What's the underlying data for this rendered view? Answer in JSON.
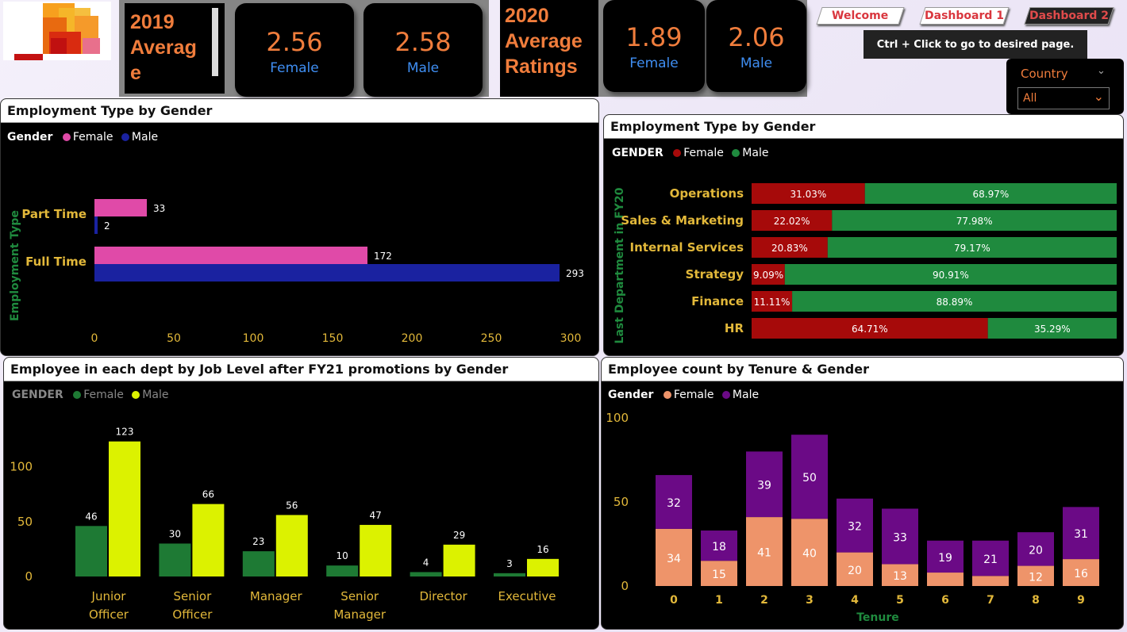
{
  "kpi2019": {
    "title": "2019\nAverag\ne",
    "female_value": "2.56",
    "female_label": "Female",
    "male_value": "2.58",
    "male_label": "Male"
  },
  "kpi2020": {
    "title": "2020\nAverage\nRatings",
    "female_value": "1.89",
    "female_label": "Female",
    "male_value": "2.06",
    "male_label": "Male"
  },
  "nav": {
    "welcome": "Welcome",
    "dashboard1": "Dashboard 1",
    "dashboard2": "Dashboard 2",
    "tip": "Ctrl + Click to go to desired page."
  },
  "slicer": {
    "label": "Country",
    "value": "All"
  },
  "panels": {
    "emp_type": {
      "title": "Employment Type by Gender",
      "legend_title": "Gender",
      "female": "Female",
      "male": "Male"
    },
    "dept": {
      "title": "Employment Type by Gender",
      "legend_title": "GENDER",
      "female": "Female",
      "male": "Male"
    },
    "joblevel": {
      "title": "Employee in each dept by Job Level after FY21 promotions by Gender",
      "legend_title": "GENDER",
      "female": "Female",
      "male": "Male"
    },
    "tenure": {
      "title": "Employee count by Tenure & Gender",
      "legend_title": "Gender",
      "female": "Female",
      "male": "Male"
    }
  },
  "colors": {
    "accent_orange": "#f07d3c",
    "blue_label": "#3f8ef2",
    "pink": "#e04aa8",
    "navy": "#1a22a0",
    "dark_red": "#a60a0a",
    "green": "#1f8a3e",
    "dark_green": "#1e7a34",
    "lime": "#dcf200",
    "salmon": "#ee946a",
    "purple": "#6b0a86",
    "gold": "#e2b83a"
  },
  "chart_data": [
    {
      "type": "bar",
      "orientation": "horizontal",
      "title": "Employment Type by Gender",
      "ylabel": "Employment Type",
      "categories": [
        "Part Time",
        "Full Time"
      ],
      "series": [
        {
          "name": "Female",
          "values": [
            33,
            172
          ]
        },
        {
          "name": "Male",
          "values": [
            2,
            293
          ]
        }
      ],
      "xticks": [
        0,
        50,
        100,
        150,
        200,
        250,
        300
      ],
      "xlim": [
        0,
        300
      ]
    },
    {
      "type": "bar",
      "orientation": "horizontal",
      "stacked": "percent",
      "title": "Employment Type by Gender",
      "ylabel": "Last Department in FY20",
      "categories": [
        "Operations",
        "Sales & Marketing",
        "Internal Services",
        "Strategy",
        "Finance",
        "HR"
      ],
      "series": [
        {
          "name": "Female",
          "values": [
            31.03,
            22.02,
            20.83,
            9.09,
            11.11,
            64.71
          ]
        },
        {
          "name": "Male",
          "values": [
            68.97,
            77.98,
            79.17,
            90.91,
            88.89,
            35.29
          ]
        }
      ]
    },
    {
      "type": "bar",
      "title": "Employee in each dept by Job Level after FY21 promotions by Gender",
      "categories": [
        "Junior\nOfficer",
        "Senior\nOfficer",
        "Manager",
        "Senior\nManager",
        "Director",
        "Executive"
      ],
      "series": [
        {
          "name": "Female",
          "values": [
            46,
            30,
            23,
            10,
            4,
            3
          ]
        },
        {
          "name": "Male",
          "values": [
            123,
            66,
            56,
            47,
            29,
            16
          ]
        }
      ],
      "yticks": [
        0,
        50,
        100
      ],
      "ylim": [
        0,
        130
      ]
    },
    {
      "type": "bar",
      "stacked": true,
      "title": "Employee count by Tenure & Gender",
      "xlabel": "Tenure",
      "categories": [
        "0",
        "1",
        "2",
        "3",
        "4",
        "5",
        "6",
        "7",
        "8",
        "9"
      ],
      "series": [
        {
          "name": "Female",
          "values": [
            34,
            15,
            41,
            40,
            20,
            13,
            8,
            6,
            12,
            16
          ]
        },
        {
          "name": "Male",
          "values": [
            32,
            18,
            39,
            50,
            32,
            33,
            19,
            21,
            20,
            31
          ]
        }
      ],
      "female_labels_shown": [
        "34",
        "15",
        "41",
        "40",
        "20",
        "13",
        "",
        "",
        "12",
        "16"
      ],
      "yticks": [
        0,
        50,
        100
      ],
      "ylim": [
        0,
        100
      ]
    }
  ]
}
